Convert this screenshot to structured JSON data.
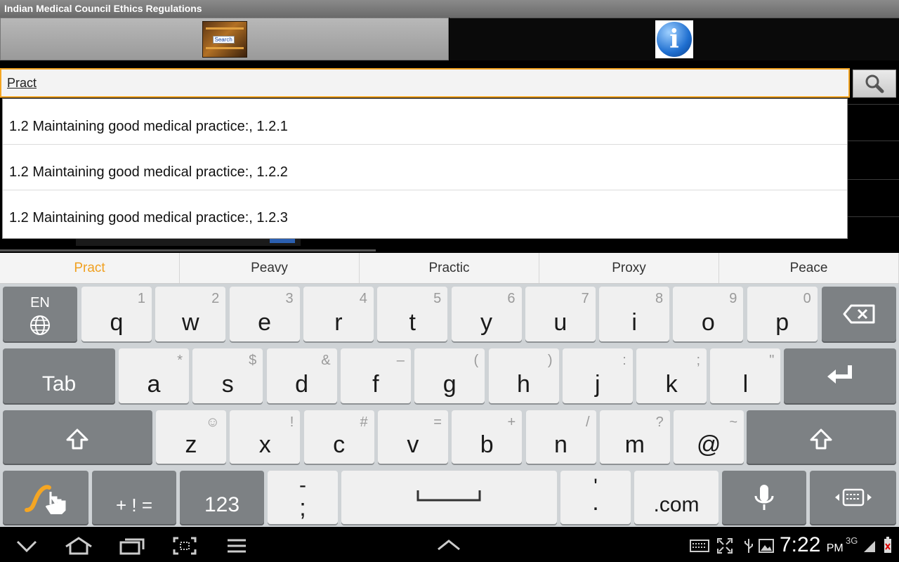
{
  "app": {
    "title": "Indian Medical Council Ethics Regulations"
  },
  "tabs": {
    "search_label": "Search"
  },
  "search": {
    "value": "Pract"
  },
  "suggestions": [
    "1.2 Maintaining good medical practice:, 1.2.1",
    "1.2 Maintaining good medical practice:, 1.2.2",
    "1.2 Maintaining good medical practice:, 1.2.3"
  ],
  "predictions": [
    "Pract",
    "Peavy",
    "Practic",
    "Proxy",
    "Peace"
  ],
  "keyboard": {
    "lang": "EN",
    "row1": [
      {
        "k": "q",
        "s": "1"
      },
      {
        "k": "w",
        "s": "2"
      },
      {
        "k": "e",
        "s": "3"
      },
      {
        "k": "r",
        "s": "4"
      },
      {
        "k": "t",
        "s": "5"
      },
      {
        "k": "y",
        "s": "6"
      },
      {
        "k": "u",
        "s": "7"
      },
      {
        "k": "i",
        "s": "8"
      },
      {
        "k": "o",
        "s": "9"
      },
      {
        "k": "p",
        "s": "0"
      }
    ],
    "row2": [
      {
        "k": "a",
        "s": "*"
      },
      {
        "k": "s",
        "s": "$"
      },
      {
        "k": "d",
        "s": "&"
      },
      {
        "k": "f",
        "s": "–"
      },
      {
        "k": "g",
        "s": "("
      },
      {
        "k": "h",
        "s": ")"
      },
      {
        "k": "j",
        "s": ":"
      },
      {
        "k": "k",
        "s": ";"
      },
      {
        "k": "l",
        "s": "\""
      }
    ],
    "row3": [
      {
        "k": "z",
        "s": "☺"
      },
      {
        "k": "x",
        "s": "!"
      },
      {
        "k": "c",
        "s": "#"
      },
      {
        "k": "v",
        "s": "="
      },
      {
        "k": "b",
        "s": "+"
      },
      {
        "k": "n",
        "s": "/"
      },
      {
        "k": "m",
        "s": "?"
      },
      {
        "k": "@",
        "s": "~"
      }
    ],
    "tab_label": "Tab",
    "symbols_label": "+ ! =",
    "numbers_label": "123",
    "dash_semicolon_top": "-",
    "dash_semicolon_bottom": ";",
    "quote_period_top": "'",
    "quote_period_bottom": ".",
    "dotcom_label": ".com"
  },
  "status": {
    "time": "7:22",
    "ampm": "PM",
    "network": "3G"
  }
}
